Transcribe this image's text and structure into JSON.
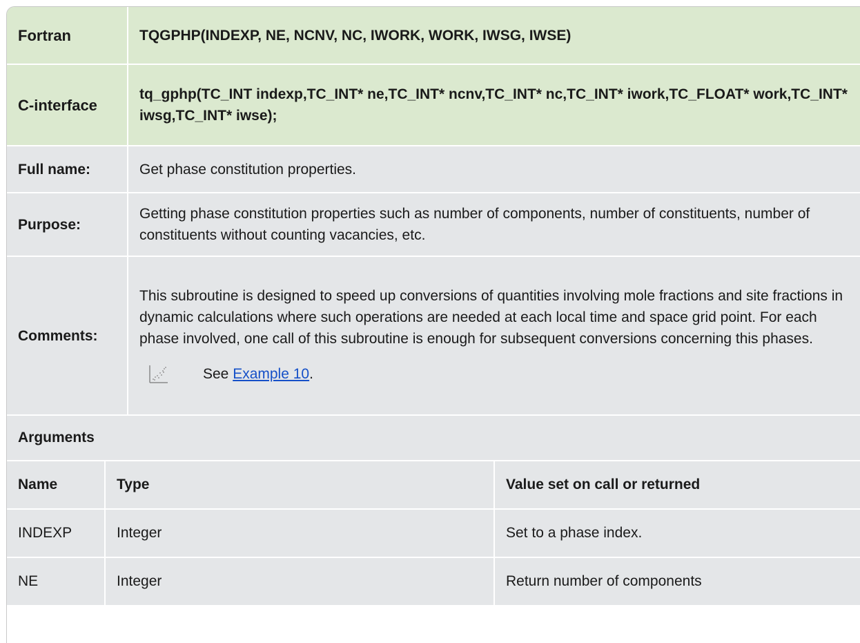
{
  "signature": {
    "fortran_label": "Fortran",
    "fortran_code": "TQGPHP(INDEXP, NE, NCNV, NC, IWORK, WORK, IWSG, IWSE)",
    "c_label": "C-interface",
    "c_code": "tq_gphp(TC_INT indexp,TC_INT* ne,TC_INT* ncnv,TC_INT* nc,TC_INT* iwork,TC_FLOAT* work,TC_INT* iwsg,TC_INT* iwse);"
  },
  "fullname": {
    "label": "Full name:",
    "value": "Get phase constitution properties."
  },
  "purpose": {
    "label": "Purpose:",
    "value": "Getting phase constitution properties such as number of components, number of constituents, number of constituents without counting vacancies, etc."
  },
  "comments": {
    "label": "Comments:",
    "value": "This subroutine is designed to speed up conversions of quantities involving mole fractions and site fractions in dynamic calculations where such operations are needed at each local time and space grid point. For each phase involved, one call of this subroutine is enough for subsequent conversions concerning this phases.",
    "see_prefix": "See ",
    "see_link": "Example 10",
    "see_suffix": ".",
    "icon": "example-chart-icon"
  },
  "arguments": {
    "title": "Arguments",
    "headers": [
      "Name",
      "Type",
      "Value set on call or returned"
    ],
    "rows": [
      [
        "INDEXP",
        "Integer",
        "Set to a phase index."
      ],
      [
        "NE",
        "Integer",
        "Return number of components"
      ]
    ]
  },
  "colors": {
    "signature_bg": "#dbe9cf",
    "row_bg": "#e4e6e8",
    "link": "#1550c8"
  }
}
